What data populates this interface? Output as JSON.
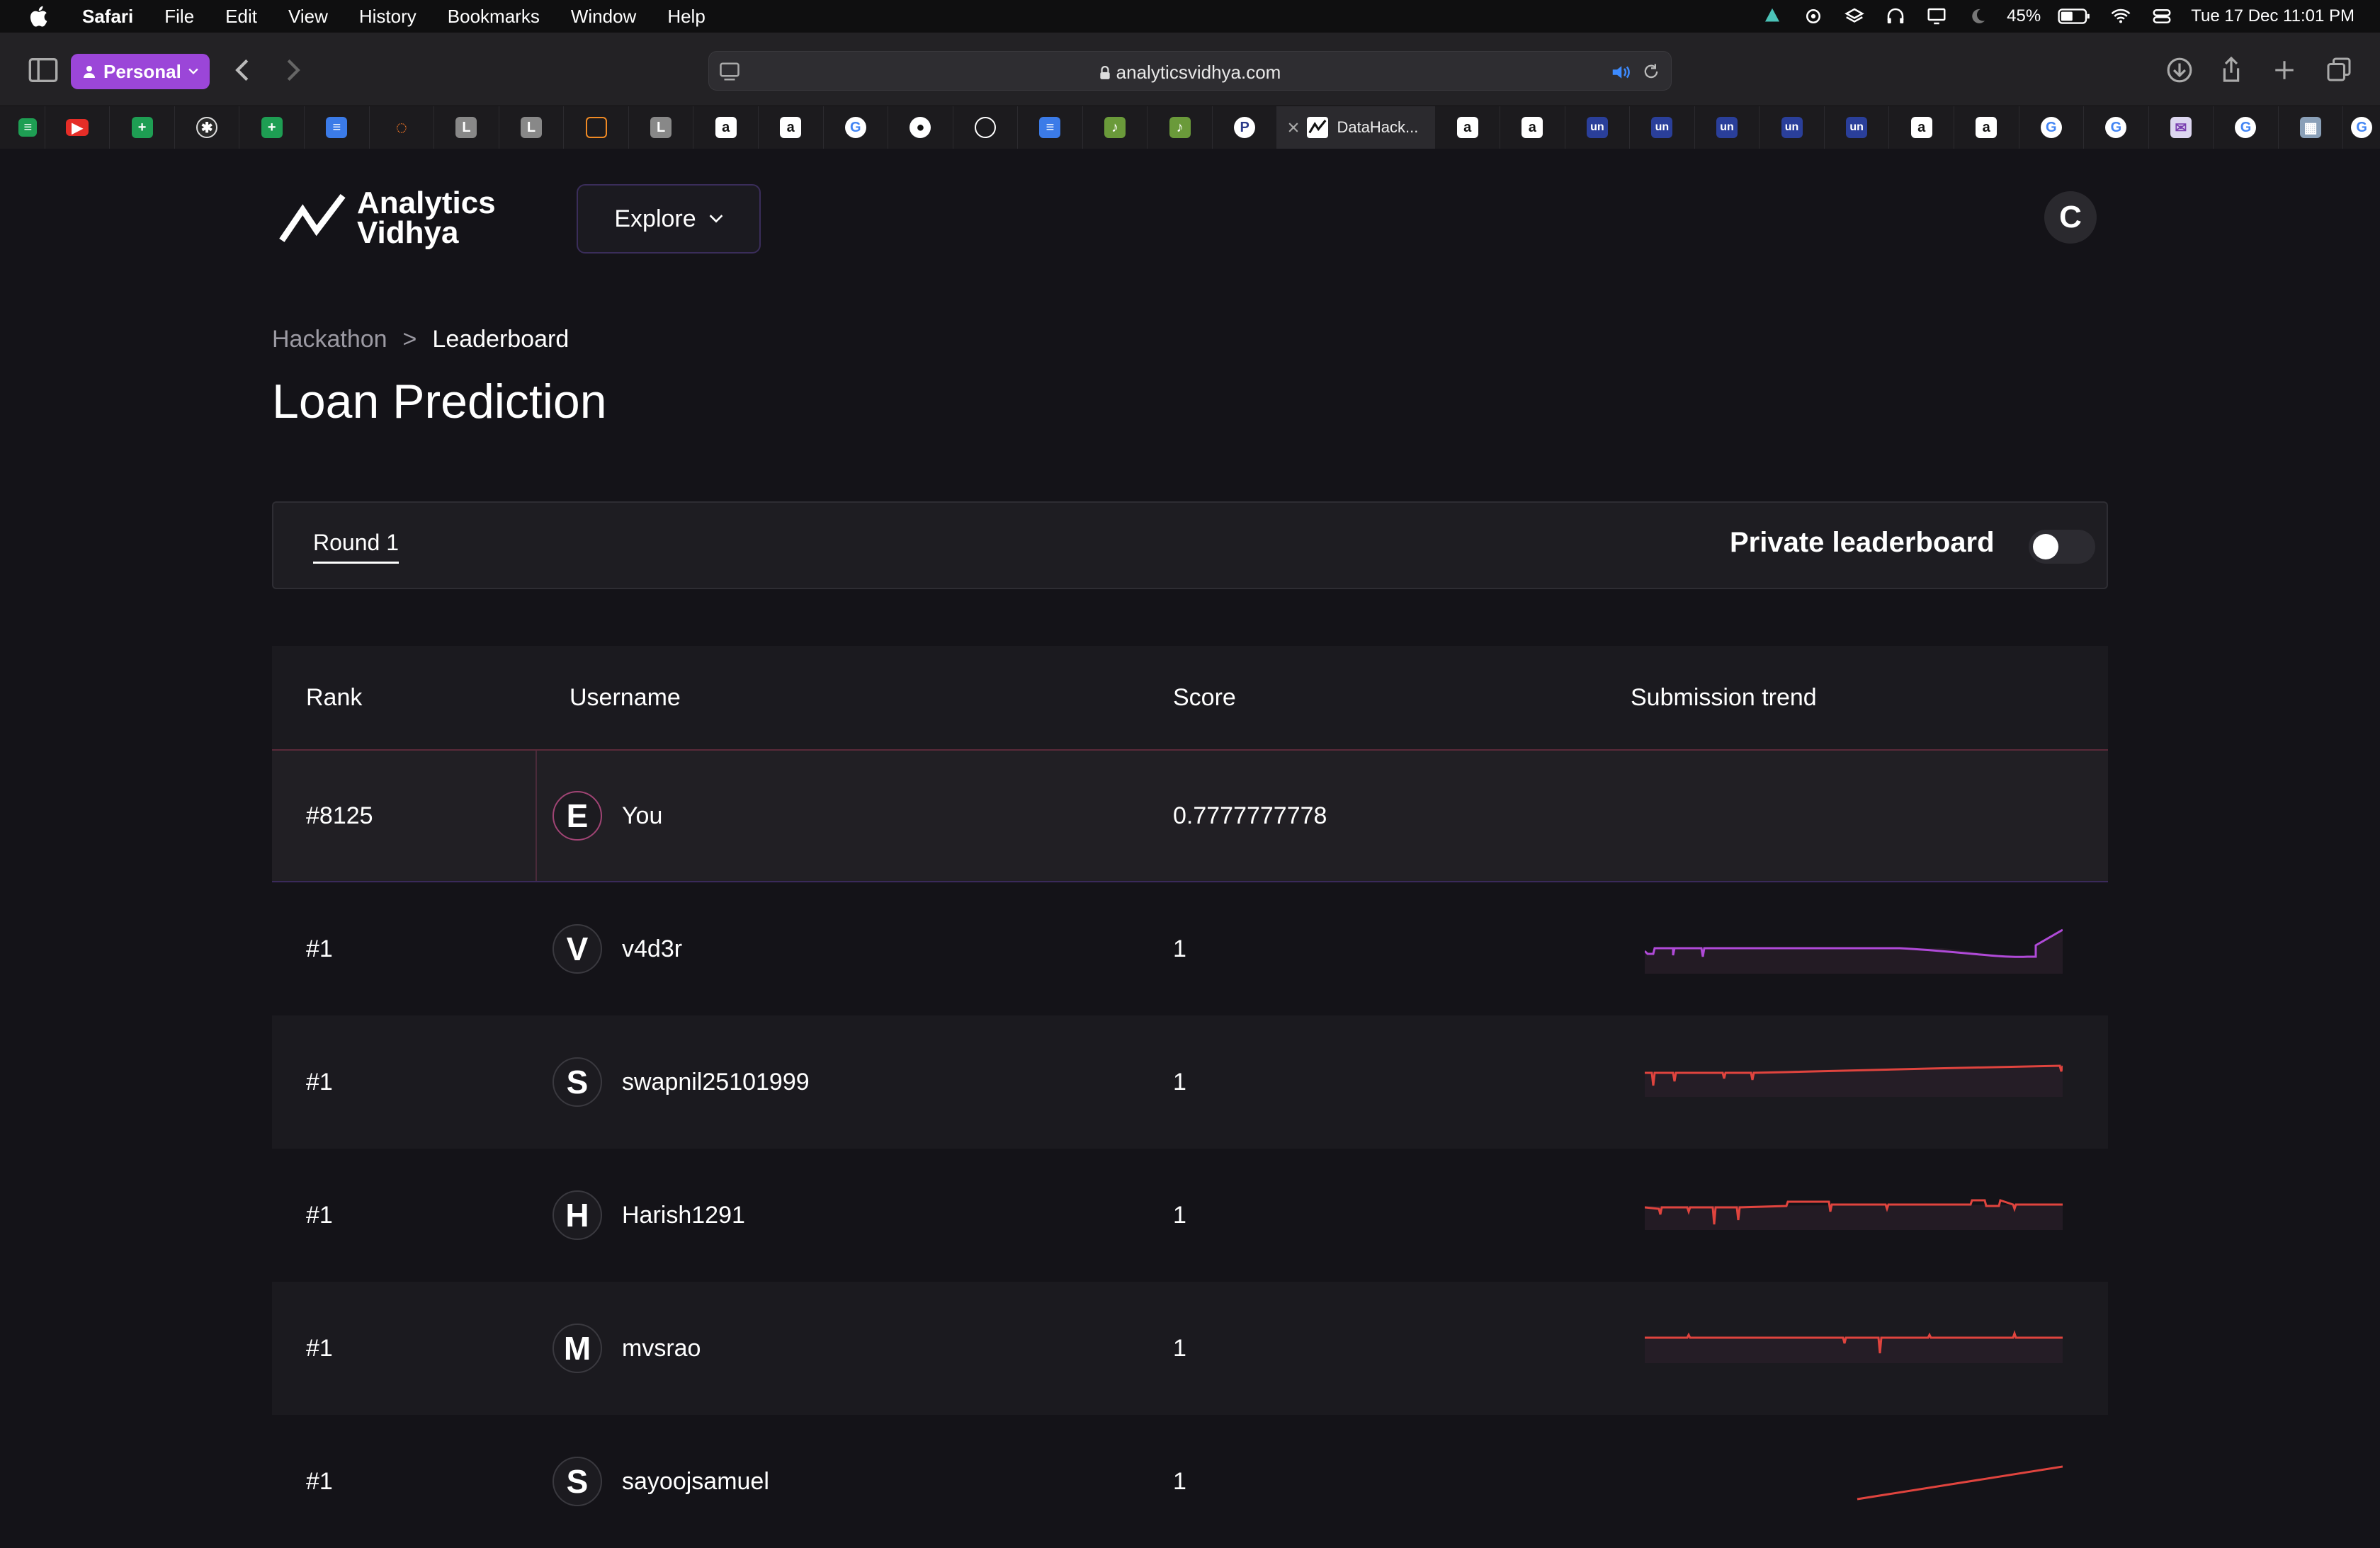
{
  "menubar": {
    "app": "Safari",
    "items": [
      "File",
      "Edit",
      "View",
      "History",
      "Bookmarks",
      "Window",
      "Help"
    ],
    "battery": "45%",
    "datetime": "Tue 17 Dec  11:01 PM"
  },
  "toolbar": {
    "profile": "Personal",
    "url": "analyticsvidhya.com"
  },
  "tabs": {
    "active_title": "DataHack..."
  },
  "header": {
    "logo_line1": "Analytics",
    "logo_line2": "Vidhya",
    "explore": "Explore",
    "avatar": "C"
  },
  "breadcrumb": {
    "parent": "Hackathon",
    "separator": ">",
    "current": "Leaderboard"
  },
  "page_title": "Loan Prediction",
  "round": {
    "tab": "Round 1",
    "private_label": "Private leaderboard",
    "private_on": false
  },
  "table": {
    "headers": {
      "rank": "Rank",
      "username": "Username",
      "score": "Score",
      "trend": "Submission trend"
    },
    "rows": [
      {
        "rank": "#8125",
        "initial": "E",
        "username": "You",
        "score": "0.7777777778"
      },
      {
        "rank": "#1",
        "initial": "V",
        "username": "v4d3r",
        "score": "1"
      },
      {
        "rank": "#1",
        "initial": "S",
        "username": "swapnil25101999",
        "score": "1"
      },
      {
        "rank": "#1",
        "initial": "H",
        "username": "Harish1291",
        "score": "1"
      },
      {
        "rank": "#1",
        "initial": "M",
        "username": "mvsrao",
        "score": "1"
      },
      {
        "rank": "#1",
        "initial": "S",
        "username": "sayoojsamuel",
        "score": "1"
      }
    ]
  },
  "colors": {
    "accent": "#9b46d8",
    "trend_red": "#e0443e",
    "trend_purple": "#b04ad8"
  }
}
